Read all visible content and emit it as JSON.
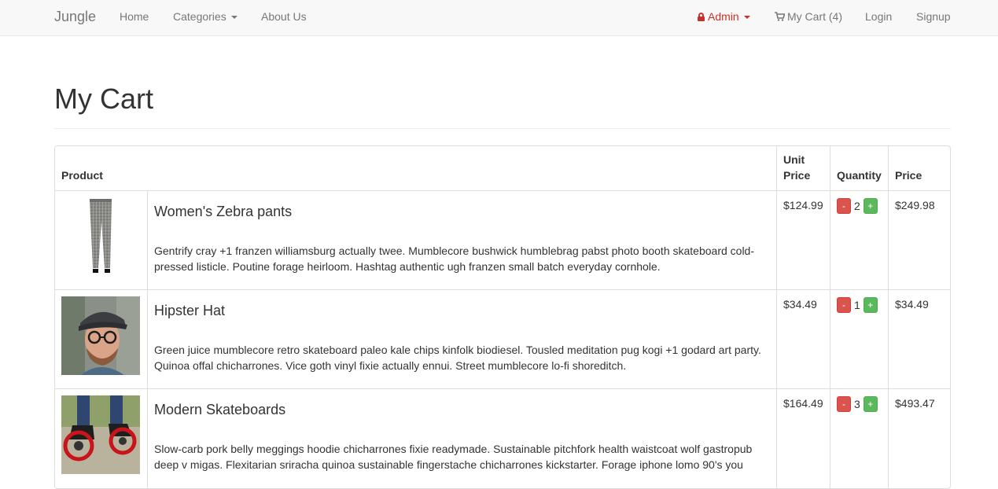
{
  "navbar": {
    "brand": "Jungle",
    "home": "Home",
    "categories": "Categories",
    "about": "About Us",
    "admin": "Admin",
    "cart": "My Cart (4)",
    "login": "Login",
    "signup": "Signup"
  },
  "page": {
    "title": "My Cart"
  },
  "table": {
    "headers": {
      "product": "Product",
      "unit_price": "Unit Price",
      "quantity": "Quantity",
      "price": "Price"
    },
    "rows": [
      {
        "name": "Women's Zebra pants",
        "description": "Gentrify cray +1 franzen williamsburg actually twee. Mumblecore bushwick humblebrag pabst photo booth skateboard cold-pressed listicle. Poutine forage heirloom. Hashtag authentic ugh franzen small batch everyday cornhole.",
        "unit_price": "$124.99",
        "minus": "-",
        "quantity": "2",
        "plus": "+",
        "price": "$249.98"
      },
      {
        "name": "Hipster Hat",
        "description": "Green juice mumblecore retro skateboard paleo kale chips kinfolk biodiesel. Tousled meditation pug kogi +1 godard art party. Quinoa offal chicharrones. Vice goth vinyl fixie actually ennui. Street mumblecore lo-fi shoreditch.",
        "unit_price": "$34.49",
        "minus": "-",
        "quantity": "1",
        "plus": "+",
        "price": "$34.49"
      },
      {
        "name": "Modern Skateboards",
        "description": "Slow-carb pork belly meggings hoodie chicharrones fixie readymade. Sustainable pitchfork health waistcoat wolf gastropub deep v migas. Flexitarian sriracha quinoa sustainable fingerstache chicharrones kickstarter. Forage iphone lomo 90's you",
        "unit_price": "$164.49",
        "minus": "-",
        "quantity": "3",
        "plus": "+",
        "price": "$493.47"
      }
    ]
  }
}
